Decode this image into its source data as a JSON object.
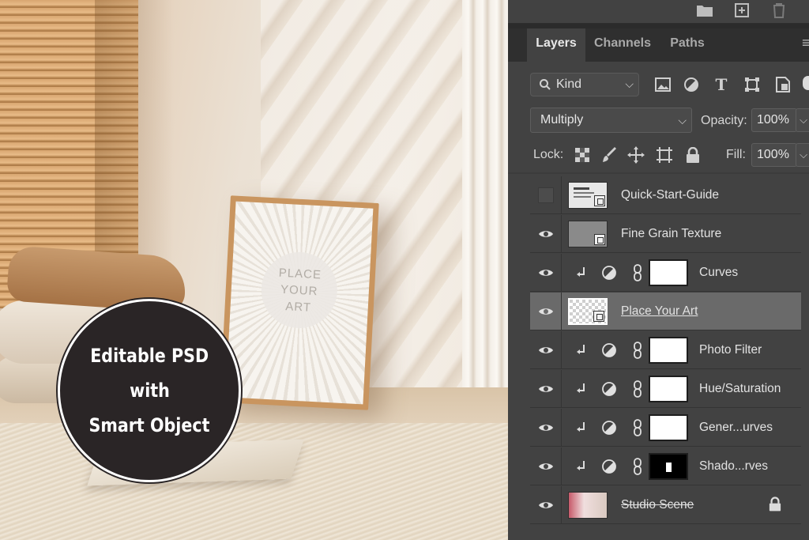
{
  "photo": {
    "frame_text": "PLACE\nYOUR\nART",
    "badge_lines": [
      "Editable PSD",
      "with",
      "Smart Object"
    ]
  },
  "panel": {
    "top_icons": [
      "folder-icon",
      "new-layer-icon",
      "trash-icon"
    ],
    "tabs": [
      {
        "label": "Layers",
        "active": true
      },
      {
        "label": "Channels",
        "active": false
      },
      {
        "label": "Paths",
        "active": false
      }
    ],
    "filter": {
      "kind_label": "Kind",
      "icons": [
        "image-filter-icon",
        "adjustment-filter-icon",
        "type-filter-icon",
        "shape-filter-icon",
        "smart-object-filter-icon"
      ]
    },
    "blend_mode": "Multiply",
    "opacity_label": "Opacity:",
    "opacity_value": "100%",
    "lock_label": "Lock:",
    "fill_label": "Fill:",
    "fill_value": "100%",
    "layers": [
      {
        "name": "Quick-Start-Guide",
        "visible": false,
        "type": "smart-object"
      },
      {
        "name": "Fine Grain Texture",
        "visible": true,
        "type": "smart-object"
      },
      {
        "name": "Curves",
        "visible": true,
        "type": "adjustment"
      },
      {
        "name": "Place Your Art",
        "visible": true,
        "type": "smart-object",
        "selected": true
      },
      {
        "name": "Photo Filter",
        "visible": true,
        "type": "adjustment"
      },
      {
        "name": "Hue/Saturation",
        "visible": true,
        "type": "adjustment"
      },
      {
        "name": "Gener...urves",
        "visible": true,
        "type": "adjustment"
      },
      {
        "name": "Shado...rves",
        "visible": true,
        "type": "adjustment"
      },
      {
        "name": "Studio Scene",
        "visible": true,
        "type": "background",
        "locked": true
      }
    ]
  }
}
